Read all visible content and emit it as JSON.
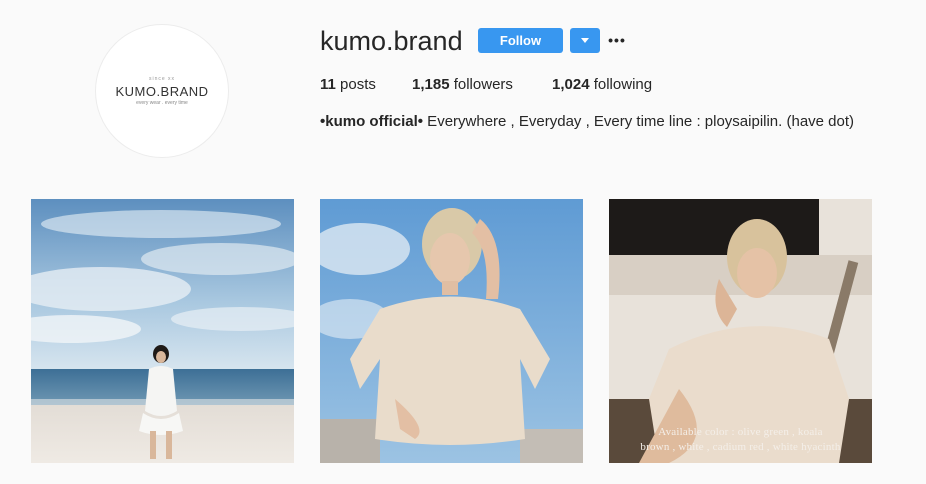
{
  "profile": {
    "avatar": {
      "small_text": "since xx",
      "brand_text": "KUMO.BRAND",
      "tagline": "every wear . every time"
    },
    "username": "kumo.brand",
    "follow_label": "Follow",
    "more_label": "•••",
    "stats": {
      "posts_count": "11",
      "posts_label": "posts",
      "followers_count": "1,185",
      "followers_label": "followers",
      "following_count": "1,024",
      "following_label": "following"
    },
    "bio": {
      "bold": "•kumo official•",
      "text": " Everywhere , Everyday , Every time line : ploysaipilin. (have dot)"
    }
  },
  "posts": [
    {
      "caption_line1": "",
      "caption_line2": ""
    },
    {
      "caption_line1": "",
      "caption_line2": ""
    },
    {
      "caption_line1": "Available color : olive green , koala",
      "caption_line2": "brown , white , cadium red , white hyacinth"
    }
  ],
  "colors": {
    "follow_button": "#3897f0",
    "background": "#fafafa",
    "text": "#262626"
  },
  "icons": [
    "chevron-down-icon",
    "more-icon"
  ]
}
